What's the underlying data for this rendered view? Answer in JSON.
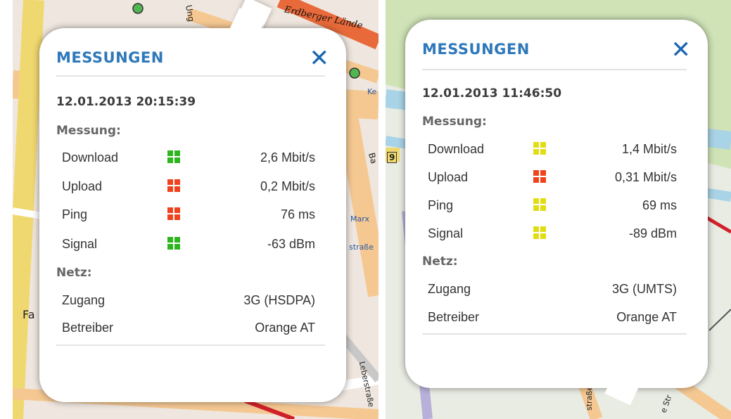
{
  "colors": {
    "green": "#2db51e",
    "red": "#f0421c",
    "yellow": "#e0dd12",
    "title_blue": "#2e78ba"
  },
  "icons": {
    "close": "close-icon",
    "indicator": "quality-squares-icon"
  },
  "popups": [
    {
      "title": "MESSUNGEN",
      "close": "✕",
      "timestamp": "12.01.2013 20:15:39",
      "measurement_label": "Messung:",
      "metrics": [
        {
          "label": "Download",
          "value": "2,6 Mbit/s",
          "level": "green"
        },
        {
          "label": "Upload",
          "value": "0,2 Mbit/s",
          "level": "red"
        },
        {
          "label": "Ping",
          "value": "76 ms",
          "level": "red"
        },
        {
          "label": "Signal",
          "value": "-63 dBm",
          "level": "green"
        }
      ],
      "network_label": "Netz:",
      "network": [
        {
          "label": "Zugang",
          "value": "3G (HSDPA)"
        },
        {
          "label": "Betreiber",
          "value": "Orange AT"
        }
      ]
    },
    {
      "title": "MESSUNGEN",
      "close": "✕",
      "timestamp": "12.01.2013 11:46:50",
      "measurement_label": "Messung:",
      "metrics": [
        {
          "label": "Download",
          "value": "1,4 Mbit/s",
          "level": "yellow"
        },
        {
          "label": "Upload",
          "value": "0,31 Mbit/s",
          "level": "red"
        },
        {
          "label": "Ping",
          "value": "69 ms",
          "level": "yellow"
        },
        {
          "label": "Signal",
          "value": "-89 dBm",
          "level": "yellow"
        }
      ],
      "network_label": "Netz:",
      "network": [
        {
          "label": "Zugang",
          "value": "3G (UMTS)"
        },
        {
          "label": "Betreiber",
          "value": "Orange AT"
        }
      ]
    }
  ],
  "map_labels": {
    "left": [
      "Erdberger Lände",
      "Ung",
      "Ke",
      "Ba",
      "Marx",
      "straße",
      "Fa",
      "Leberstraße"
    ],
    "right": [
      "9",
      "straße",
      "e Str"
    ]
  }
}
